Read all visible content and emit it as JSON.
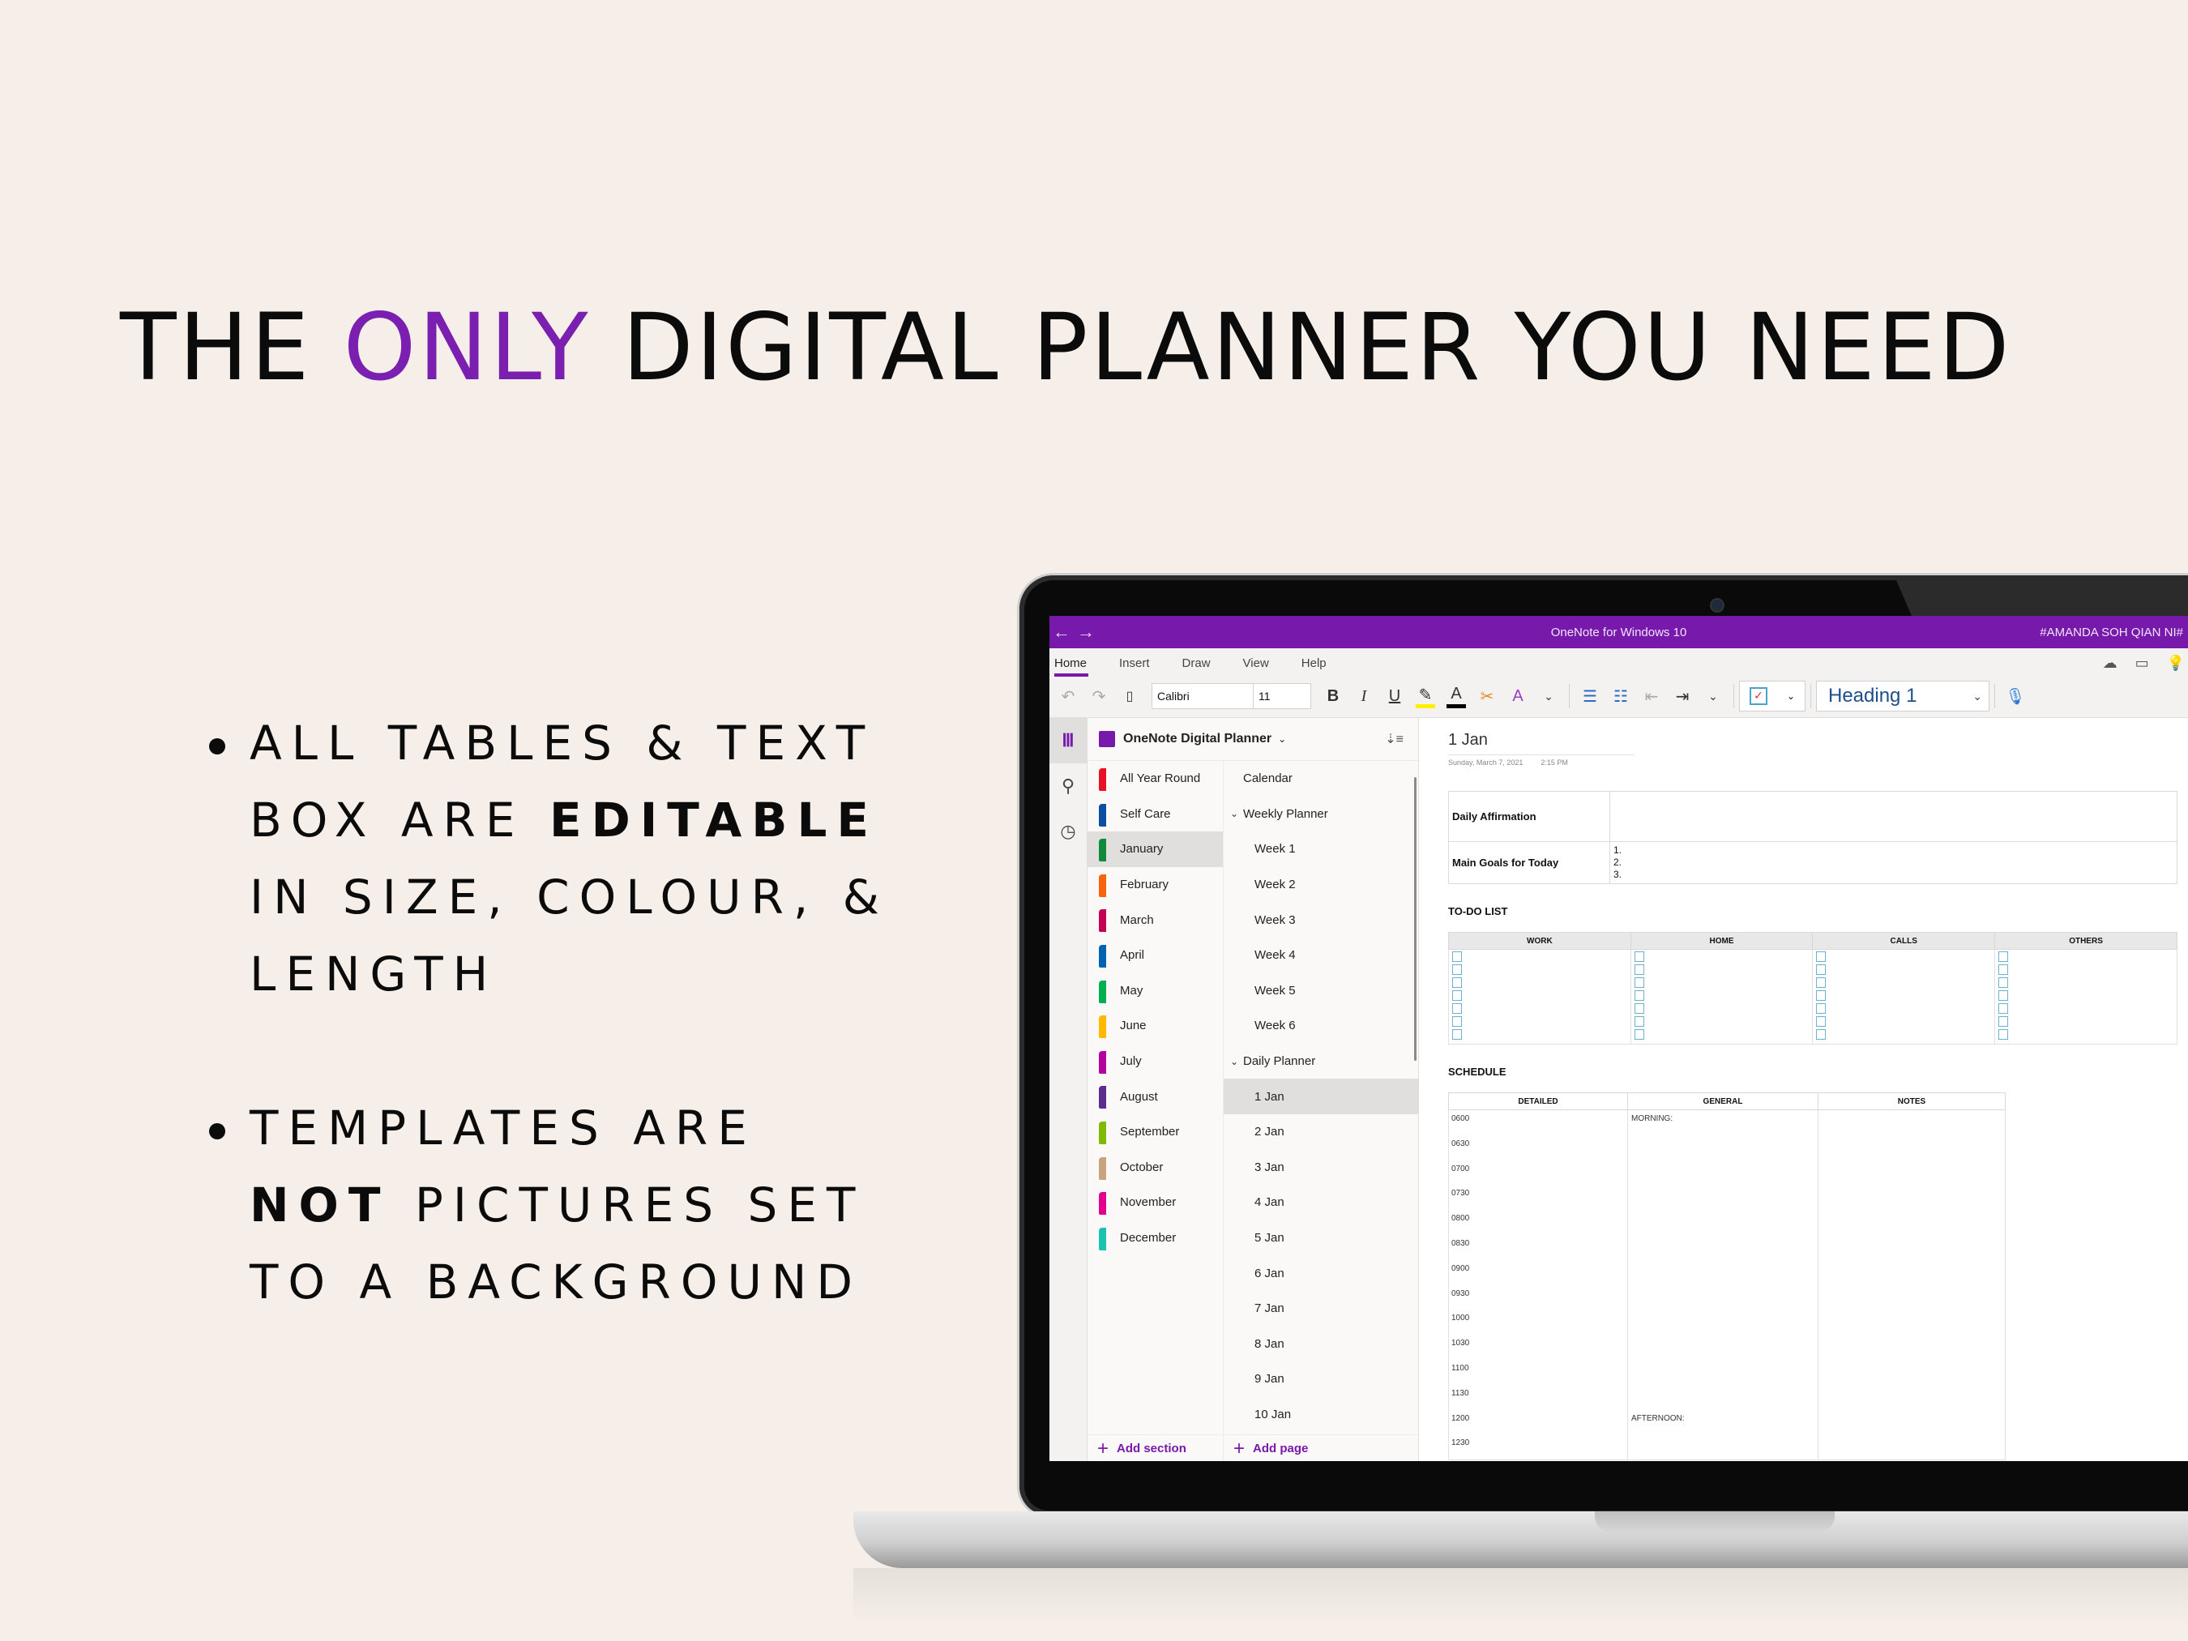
{
  "headline": {
    "before": "THE ",
    "accent": "ONLY",
    "after": " DIGITAL PLANNER YOU NEED",
    "accent_color": "#7a1fb0"
  },
  "bullets": [
    {
      "pre": "ALL TABLES & TEXT BOX ARE ",
      "bold": "EDITABLE",
      "post": " IN SIZE, COLOUR, & LENGTH"
    },
    {
      "pre": "TEMPLATES ARE ",
      "bold": "NOT",
      "post": " PICTURES SET TO A BACKGROUND"
    }
  ],
  "app": {
    "title": "OneNote for Windows 10",
    "user": "#AMANDA SOH QIAN NI#",
    "accent_color": "#7719aa",
    "nav": {
      "back_icon": "←",
      "forward_icon": "→"
    },
    "ribbon_tabs": [
      "Home",
      "Insert",
      "Draw",
      "View",
      "Help"
    ],
    "active_tab": "Home",
    "font_name": "Calibri",
    "font_size": "11",
    "style": "Heading 1",
    "toolbar_icons": {
      "undo": "↶",
      "redo": "↷",
      "paste": "📋",
      "bold": "B",
      "italic": "I",
      "underline": "U",
      "highlight": "✎",
      "font_color": "A",
      "clear_format": "⌫",
      "spell": "A",
      "more": "⌄",
      "bullets": "☰",
      "numbering": "☷",
      "outdent": "⇤",
      "indent": "⇥",
      "mic": "🎤"
    },
    "notebook": {
      "name": "OneNote Digital Planner",
      "sections": [
        {
          "label": "All Year Round",
          "color": "#e81123"
        },
        {
          "label": "Self Care",
          "color": "#0b4ea2"
        },
        {
          "label": "January",
          "color": "#0f8a3c",
          "active": true
        },
        {
          "label": "February",
          "color": "#f7630c"
        },
        {
          "label": "March",
          "color": "#c30052"
        },
        {
          "label": "April",
          "color": "#0063b1"
        },
        {
          "label": "May",
          "color": "#00b050"
        },
        {
          "label": "June",
          "color": "#ffb900"
        },
        {
          "label": "July",
          "color": "#b4009e"
        },
        {
          "label": "August",
          "color": "#5c2d91"
        },
        {
          "label": "September",
          "color": "#7fba00"
        },
        {
          "label": "October",
          "color": "#c8a47e"
        },
        {
          "label": "November",
          "color": "#e3008c"
        },
        {
          "label": "December",
          "color": "#1bc1b1"
        }
      ],
      "pages": [
        {
          "label": "Calendar",
          "level": 0
        },
        {
          "label": "Weekly Planner",
          "level": 0,
          "expanded": true
        },
        {
          "label": "Week 1",
          "level": 1
        },
        {
          "label": "Week 2",
          "level": 1
        },
        {
          "label": "Week 3",
          "level": 1
        },
        {
          "label": "Week 4",
          "level": 1
        },
        {
          "label": "Week 5",
          "level": 1
        },
        {
          "label": "Week 6",
          "level": 1
        },
        {
          "label": "Daily Planner",
          "level": 0,
          "expanded": true
        },
        {
          "label": "1 Jan",
          "level": 1,
          "active": true
        },
        {
          "label": "2 Jan",
          "level": 1
        },
        {
          "label": "3 Jan",
          "level": 1
        },
        {
          "label": "4 Jan",
          "level": 1
        },
        {
          "label": "5 Jan",
          "level": 1
        },
        {
          "label": "6 Jan",
          "level": 1
        },
        {
          "label": "7 Jan",
          "level": 1
        },
        {
          "label": "8 Jan",
          "level": 1
        },
        {
          "label": "9 Jan",
          "level": 1
        },
        {
          "label": "10 Jan",
          "level": 1
        }
      ],
      "add_section": "Add section",
      "add_page": "Add page"
    },
    "page": {
      "title": "1 Jan",
      "date": "Sunday, March 7, 2021",
      "time": "2:15 PM",
      "affirmation_label": "Daily Affirmation",
      "goals_label": "Main Goals for Today",
      "goals": [
        "1.",
        "2.",
        "3."
      ],
      "todo_title": "TO-DO LIST",
      "todo_columns": [
        "WORK",
        "HOME",
        "CALLS",
        "OTHERS"
      ],
      "todo_rows": 7,
      "schedule_title": "SCHEDULE",
      "schedule_columns": [
        "DETAILED",
        "GENERAL",
        "NOTES"
      ],
      "schedule_times": [
        "0600",
        "0630",
        "0700",
        "0730",
        "0800",
        "0830",
        "0900",
        "0930",
        "1000",
        "1030",
        "1100",
        "1130",
        "1200",
        "1230"
      ],
      "schedule_general": {
        "0600": "MORNING:",
        "1200": "AFTERNOON:"
      }
    }
  }
}
